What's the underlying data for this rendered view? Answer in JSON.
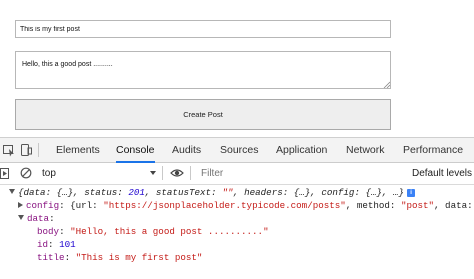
{
  "form": {
    "title_value": "This is my first post",
    "body_value": "Hello, this a good post ..........",
    "submit_label": "Create Post"
  },
  "devtools": {
    "tabs": [
      {
        "label": "Elements"
      },
      {
        "label": "Console",
        "active": true
      },
      {
        "label": "Audits"
      },
      {
        "label": "Sources"
      },
      {
        "label": "Application"
      },
      {
        "label": "Network"
      },
      {
        "label": "Performance"
      }
    ],
    "toolbar": {
      "context": "top",
      "filter_placeholder": "Filter",
      "levels_label": "Default levels"
    },
    "accent_color": "#1a73e8"
  },
  "console": {
    "line1": {
      "open_brace": "{",
      "data_key": "data",
      "data_val": ": {…}, ",
      "status_key": "status",
      "colon1": ": ",
      "status_val": "201",
      "comma1": ", ",
      "statusText_key": "statusText",
      "colon2": ": ",
      "statusText_val": "\"\"",
      "comma2": ", ",
      "headers_key": "headers",
      "headers_val": ": {…}, ",
      "config_key": "config",
      "config_val": ": {…}, …}",
      "info": "i"
    },
    "line2": {
      "key": "config",
      "colon": ": {url: ",
      "url": "\"https://jsonplaceholder.typicode.com/posts\"",
      "mid": ", method: ",
      "method": "\"post\"",
      "tail": ", data:"
    },
    "line3": {
      "key": "data",
      "colon": ":"
    },
    "line4": {
      "key": "body",
      "colon": ": ",
      "value": "\"Hello, this a good post ..........\""
    },
    "line5": {
      "key": "id",
      "colon": ": ",
      "value": "101"
    },
    "line6": {
      "key": "title",
      "colon": ": ",
      "value": "\"This is my first post\""
    }
  }
}
